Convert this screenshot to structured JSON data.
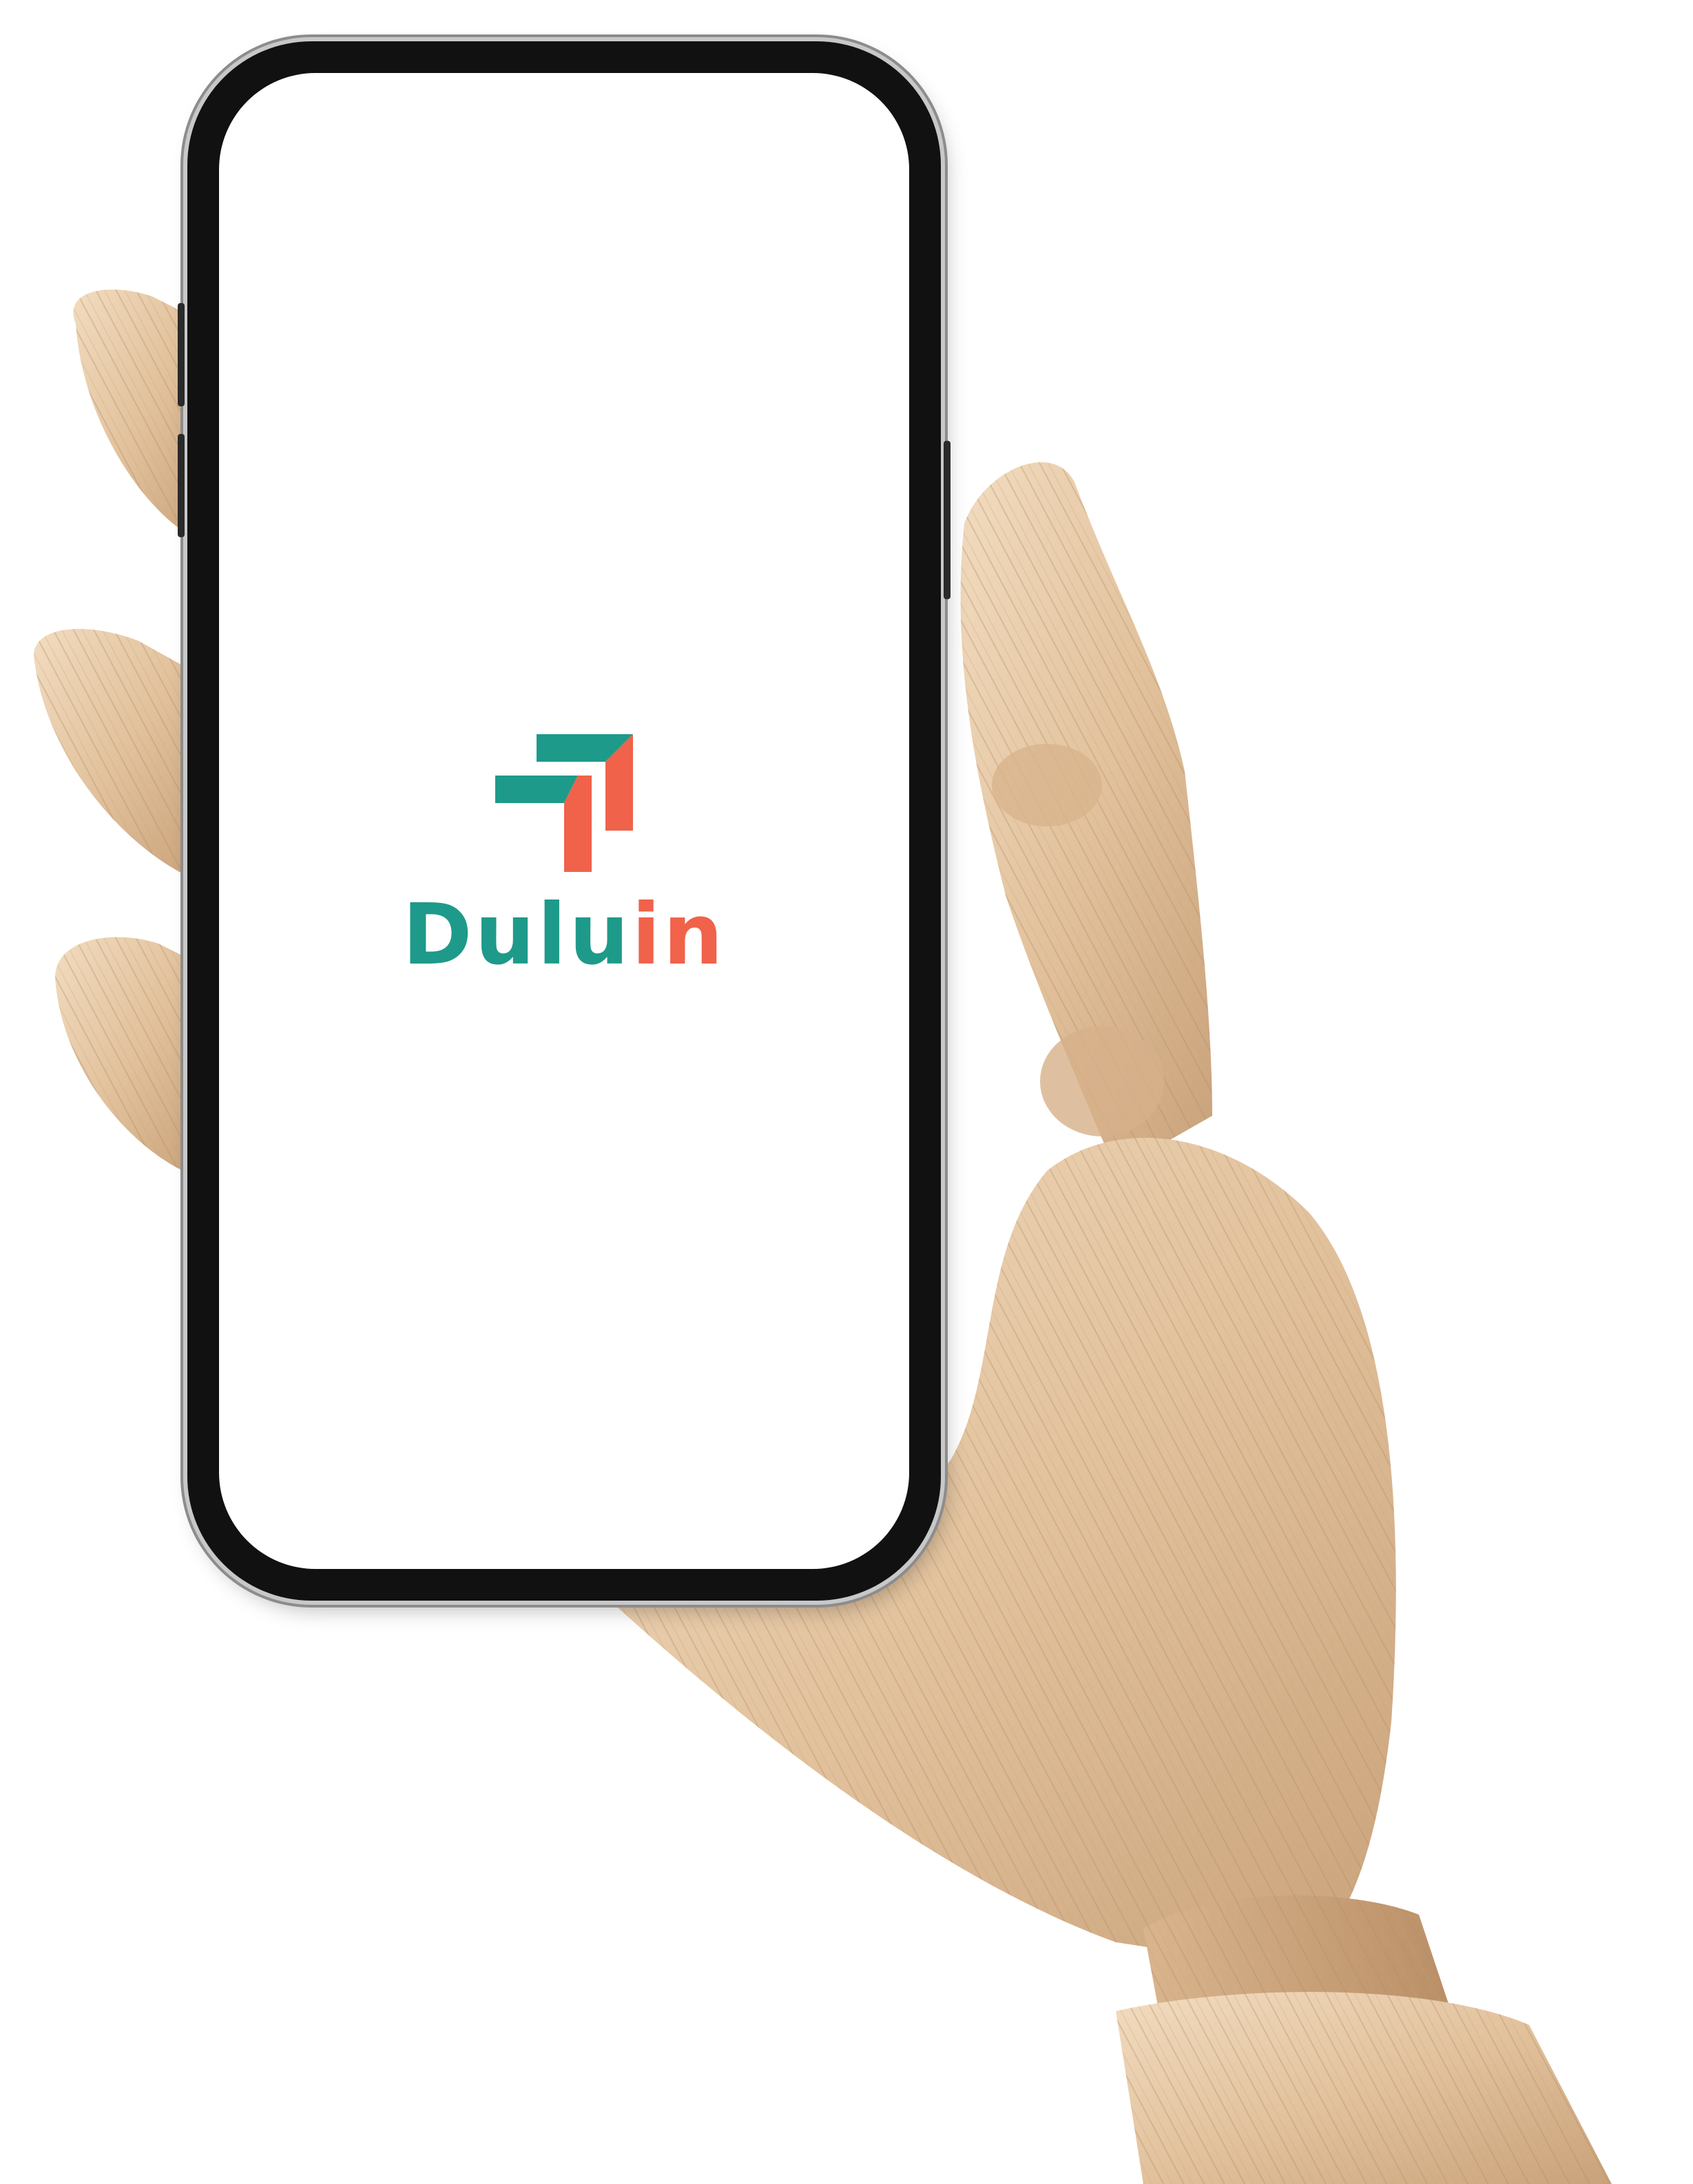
{
  "app": {
    "name_part_1": "Dulu",
    "name_part_2": "in"
  },
  "colors": {
    "teal": "#1e9a8a",
    "coral": "#f0624a",
    "screen_background": "#ffffff",
    "phone_frame": "#111111",
    "wood": "#e2c4a0"
  },
  "icons": {
    "logo": "duluin-logo-icon"
  }
}
